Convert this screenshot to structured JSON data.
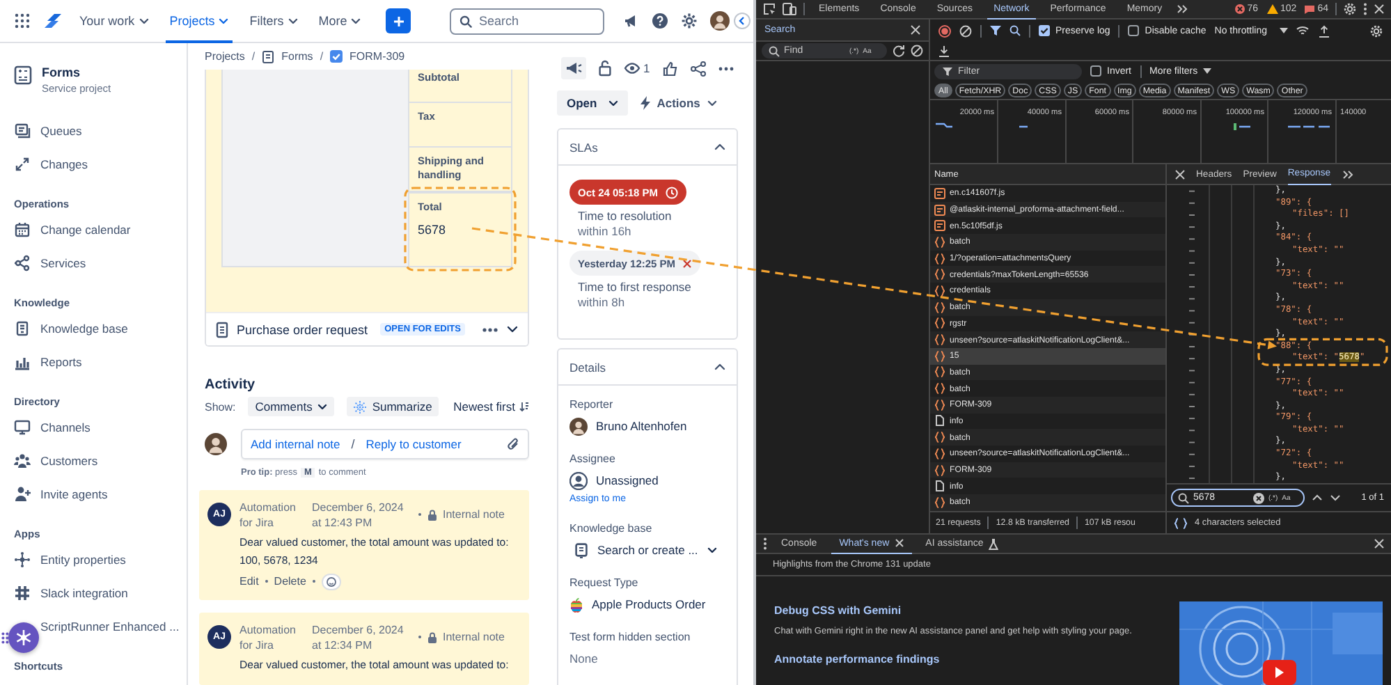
{
  "topnav": {
    "items": [
      {
        "label": "Your work",
        "selected": false
      },
      {
        "label": "Projects",
        "selected": true
      },
      {
        "label": "Filters",
        "selected": false
      },
      {
        "label": "More",
        "selected": false
      }
    ],
    "search": {
      "placeholder": "Search"
    }
  },
  "sidebar": {
    "project": {
      "name": "Forms",
      "type": "Service project"
    },
    "sections": [
      {
        "items": [
          "Queues",
          "Changes"
        ]
      },
      {
        "heading": "Operations",
        "items": [
          "Change calendar",
          "Services"
        ]
      },
      {
        "heading": "Knowledge",
        "items": [
          "Knowledge base",
          "Reports"
        ]
      },
      {
        "heading": "Directory",
        "items": [
          "Channels",
          "Customers",
          "Invite agents"
        ]
      },
      {
        "heading": "Apps",
        "items": [
          "Entity properties",
          "Slack integration",
          "ScriptRunner Enhanced ..."
        ]
      },
      {
        "heading": "Shortcuts"
      }
    ]
  },
  "breadcrumbs": {
    "separator": "/",
    "items": [
      "Projects",
      "Forms",
      "FORM-309"
    ]
  },
  "form": {
    "rows": [
      {
        "label": "Subtotal"
      },
      {
        "label": "Tax"
      },
      {
        "label": "Shipping and handling"
      },
      {
        "label": "Total",
        "value": "5678"
      }
    ],
    "title": "Purchase order request",
    "badge": "OPEN FOR EDITS"
  },
  "issue_actions": {
    "watchers": "1",
    "status": "Open",
    "actions": "Actions"
  },
  "slas": {
    "title": "SLAs",
    "expanded": true,
    "items": [
      {
        "kind": "breached",
        "time": "Oct 24 05:18 PM",
        "label": "Time to resolution",
        "limit": "within 16h"
      },
      {
        "kind": "failed",
        "time": "Yesterday 12:25 PM",
        "label": "Time to first response",
        "limit": "within 8h"
      }
    ]
  },
  "details": {
    "title": "Details",
    "expanded": true,
    "fields": [
      {
        "kind": "user",
        "label": "Reporter",
        "value": "Bruno Altenhofen"
      },
      {
        "kind": "unassigned",
        "label": "Assignee",
        "value": "Unassigned",
        "link": "Assign to me"
      },
      {
        "kind": "select",
        "label": "Knowledge base",
        "value": "Search or create ..."
      },
      {
        "kind": "request_type",
        "label": "Request Type",
        "value": "Apple Products Order"
      },
      {
        "kind": "text",
        "label": "Test form hidden section",
        "value": "None"
      }
    ]
  },
  "activity": {
    "title": "Activity",
    "show_label": "Show:",
    "filter": "Comments",
    "summarize": "Summarize",
    "sort": "Newest first",
    "note_link": "Add internal note",
    "separator": "/",
    "reply_link": "Reply to customer",
    "tip": {
      "lead": "**Pro tip:** press",
      "key": "M",
      "tail": "to comment"
    },
    "comments": [
      {
        "initials": "AJ",
        "author": "Automation for Jira",
        "date": "December 6, 2024 at 12:43 PM",
        "visibility": "Internal note",
        "body": "Dear valued customer, the total amount was updated to: 100, 5678, 1234",
        "actions": [
          "Edit",
          "Delete"
        ]
      },
      {
        "initials": "AJ",
        "author": "Automation for Jira",
        "date": "December 6, 2024 at 12:34 PM",
        "visibility": "Internal note",
        "body": "Dear valued customer, the total amount was updated to:"
      }
    ]
  },
  "devtools": {
    "tabs": [
      {
        "label": "Elements",
        "selected": false
      },
      {
        "label": "Console",
        "selected": false
      },
      {
        "label": "Sources",
        "selected": false
      },
      {
        "label": "Network",
        "selected": true
      },
      {
        "label": "Performance",
        "selected": false
      },
      {
        "label": "Memory",
        "selected": false
      }
    ],
    "counts": {
      "errors": "76",
      "warnings": "102",
      "issues": "64"
    },
    "search_panel": {
      "title": "Search",
      "placeholder": "Find",
      "regex": "(.*)",
      "case": "Aa"
    },
    "network": {
      "preserve_log": {
        "label": "Preserve log",
        "checked": true
      },
      "disable_cache": {
        "label": "Disable cache",
        "checked": false
      },
      "throttling": "No throttling",
      "filter": {
        "placeholder": "Filter"
      },
      "invert": {
        "label": "Invert",
        "checked": false
      },
      "more_filters": "More filters",
      "types": [
        {
          "label": "All",
          "selected": true
        },
        {
          "label": "Fetch/XHR",
          "selected": false
        },
        {
          "label": "Doc",
          "selected": false
        },
        {
          "label": "CSS",
          "selected": false
        },
        {
          "label": "JS",
          "selected": false
        },
        {
          "label": "Font",
          "selected": false
        },
        {
          "label": "Img",
          "selected": false
        },
        {
          "label": "Media",
          "selected": false
        },
        {
          "label": "Manifest",
          "selected": false
        },
        {
          "label": "WS",
          "selected": false
        },
        {
          "label": "Wasm",
          "selected": false
        },
        {
          "label": "Other",
          "selected": false
        }
      ],
      "overview_ticks": [
        "20000 ms",
        "40000 ms",
        "60000 ms",
        "80000 ms",
        "100000 ms",
        "120000 ms",
        "140000"
      ],
      "name_column": "Name",
      "requests": [
        {
          "name": "en.c141607f.js",
          "kind": "script",
          "selected": false
        },
        {
          "name": "@atlaskit-internal_proforma-attachment-field...",
          "kind": "script",
          "selected": false
        },
        {
          "name": "en.5c10f5df.js",
          "kind": "script",
          "selected": false
        },
        {
          "name": "batch",
          "kind": "fetch",
          "selected": false
        },
        {
          "name": "1/?operation=attachmentsQuery",
          "kind": "fetch",
          "selected": false
        },
        {
          "name": "credentials?maxTokenLength=65536",
          "kind": "fetch",
          "selected": false
        },
        {
          "name": "credentials",
          "kind": "fetch",
          "selected": false
        },
        {
          "name": "batch",
          "kind": "fetch",
          "selected": false
        },
        {
          "name": "rgstr",
          "kind": "fetch",
          "selected": false
        },
        {
          "name": "unseen?source=atlaskitNotificationLogClient&...",
          "kind": "fetch",
          "selected": false
        },
        {
          "name": "15",
          "kind": "fetch",
          "selected": true
        },
        {
          "name": "batch",
          "kind": "fetch",
          "selected": false
        },
        {
          "name": "batch",
          "kind": "fetch",
          "selected": false
        },
        {
          "name": "FORM-309",
          "kind": "fetch",
          "selected": false
        },
        {
          "name": "info",
          "kind": "doc",
          "selected": false
        },
        {
          "name": "batch",
          "kind": "fetch",
          "selected": false
        },
        {
          "name": "unseen?source=atlaskitNotificationLogClient&...",
          "kind": "fetch",
          "selected": false
        },
        {
          "name": "FORM-309",
          "kind": "fetch",
          "selected": false
        },
        {
          "name": "info",
          "kind": "doc",
          "selected": false
        },
        {
          "name": "batch",
          "kind": "fetch",
          "selected": false
        }
      ],
      "detail_tabs": [
        {
          "label": "Headers",
          "selected": false
        },
        {
          "label": "Preview",
          "selected": false
        },
        {
          "label": "Response",
          "selected": true
        }
      ],
      "response": {
        "first": "},",
        "blocks": [
          {
            "open": "\"89\": {",
            "body": "\"files\": []",
            "close": "},"
          },
          {
            "open": "\"84\": {",
            "body": "\"text\": \"\"",
            "close": "},"
          },
          {
            "open": "\"73\": {",
            "body": "\"text\": \"\"",
            "close": "},"
          },
          {
            "open": "\"78\": {",
            "body": "\"text\": \"\"",
            "close": "},"
          },
          {
            "open": "\"88\": {",
            "body": "\"text\": \"",
            "match": "5678",
            "tail": "\"",
            "close": "},"
          },
          {
            "open": "\"77\": {",
            "body": "\"text\": \"\"",
            "close": "},"
          },
          {
            "open": "\"79\": {",
            "body": "\"text\": \"\"",
            "close": "},"
          },
          {
            "open": "\"72\": {",
            "body": "\"text\": \"\"",
            "close": "},"
          }
        ]
      },
      "find": {
        "value": "5678",
        "regex": "(.*)",
        "case": "Aa",
        "count": "1 of 1"
      },
      "status": [
        "21 requests",
        "12.8 kB transferred",
        "107 kB resou"
      ],
      "selection": "4 characters selected"
    },
    "drawer": {
      "tabs": [
        {
          "label": "Console",
          "selected": false,
          "closable": false,
          "experimental": false
        },
        {
          "label": "What's new",
          "selected": true,
          "closable": true,
          "experimental": false
        },
        {
          "label": "AI assistance",
          "selected": false,
          "closable": false,
          "experimental": true
        }
      ],
      "subtitle": "Highlights from the Chrome 131 update",
      "articles": [
        {
          "title": "Debug CSS with Gemini",
          "text": "Chat with Gemini right in the new AI assistance panel and get help with styling your page."
        },
        {
          "title": "Annotate performance findings"
        }
      ]
    }
  }
}
